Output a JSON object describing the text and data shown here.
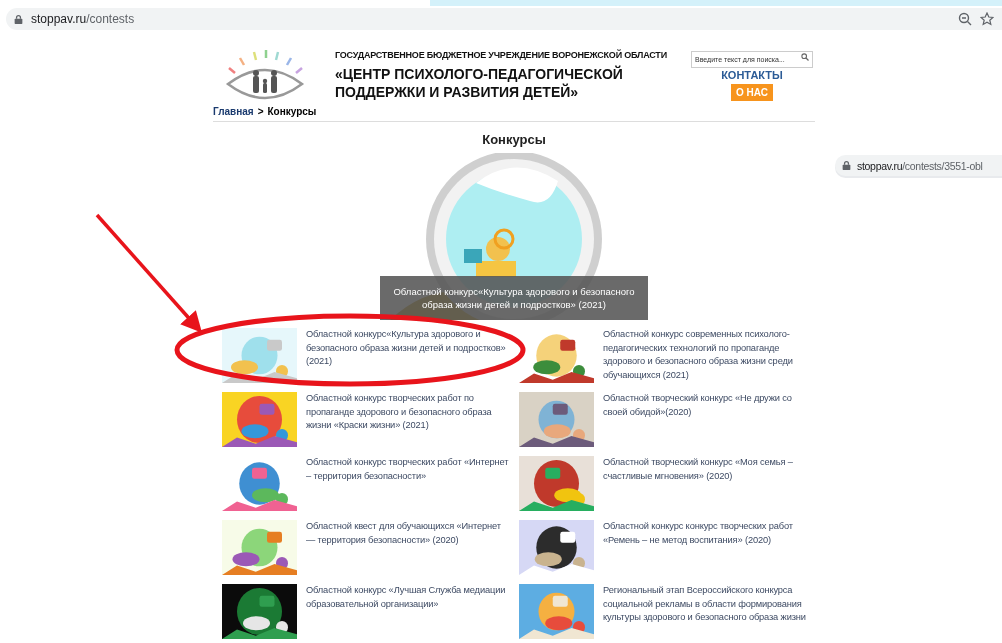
{
  "browser_main": {
    "url_host": "stoppav.ru",
    "url_path": "/contests"
  },
  "browser_overlay": {
    "url_host": "stoppav.ru",
    "url_path": "/contests/3551-obl"
  },
  "header": {
    "org_line": "ГОСУДАРСТВЕННОЕ БЮДЖЕТНОЕ УЧРЕЖДЕНИЕ ВОРОНЕЖСКОЙ ОБЛАСТИ",
    "title_lines": [
      "«ЦЕНТР ПСИХОЛОГО-ПЕДАГОГИЧЕСКОЙ",
      "ПОДДЕРЖКИ И РАЗВИТИЯ ДЕТЕЙ»"
    ],
    "search": {
      "placeholder": "Введите текст для поиска..."
    },
    "contacts_link": "КОНТАКТЫ",
    "about_button": "О НАС"
  },
  "breadcrumb": {
    "home": "Главная",
    "separator": ">",
    "current": "Конкурсы"
  },
  "heading": "Конкурсы",
  "featured": {
    "kind": "picture",
    "caption": "Областной конкурс«Культура здорового и безопасного образа жизни детей и подростков» (2021)"
  },
  "contests": [
    {
      "title": "Областной конкурс«Культура здорового и безопасного образа жизни детей и подростков» (2021)",
      "circled": true
    },
    {
      "title": "Областной конкурс современных психолого-педагогических технологий по пропаганде здорового и безопасного образа жизни среди обучающихся (2021)",
      "circled": false
    },
    {
      "title": "Областной конкурс творческих работ по пропаганде здорового и безопасного образа жизни «Краски жизни» (2021)",
      "circled": false
    },
    {
      "title": "Областной творческий конкурс «Не дружи со своей обидой»(2020)",
      "circled": false
    },
    {
      "title": "Областной конкурс творческих работ «Интернет – территория безопасности»",
      "circled": false
    },
    {
      "title": "Областной творческий конкурс «Моя семья – счастливые мгновения» (2020)",
      "circled": false
    },
    {
      "title": "Областной квест для обучающихся «Интернет — территория безопасности» (2020)",
      "circled": false
    },
    {
      "title": "Областной конкурс конкурс творческих работ «Ремень – не метод воспитания» (2020)",
      "circled": false
    },
    {
      "title": "Областной конкурс «Лучшая Служба медиации образовательной организации»",
      "circled": false
    },
    {
      "title": "Региональный этап Всероссийского конкурса социальной рекламы в области формирования культуры здорового и безопасного образа жизни",
      "circled": false
    }
  ]
}
